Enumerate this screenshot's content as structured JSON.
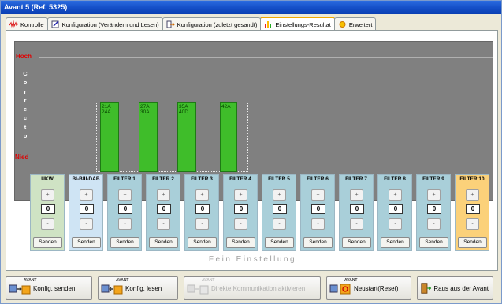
{
  "window": {
    "title": "Avant 5 (Ref. 5325)"
  },
  "tabs": [
    {
      "label": "Kontrolle",
      "icon": "wave-icon",
      "active": false
    },
    {
      "label": "Konfiguration (Verändern und Lesen)",
      "icon": "edit-icon",
      "active": false
    },
    {
      "label": "Konfiguration (zuletzt gesandt)",
      "icon": "arrow-icon",
      "active": false
    },
    {
      "label": "Einstellungs-Resultat",
      "icon": "bar-chart-icon",
      "active": true
    },
    {
      "label": "Erweitert",
      "icon": "sun-icon",
      "active": false
    }
  ],
  "chart": {
    "high_label": "Hoch",
    "low_label": "Nied",
    "axis_letters": [
      "C",
      "o",
      "r",
      "r",
      "e",
      "c",
      "t",
      "o"
    ],
    "bars": [
      {
        "line1": "21A",
        "line2": "24A"
      },
      {
        "line1": "27A",
        "line2": "30A"
      },
      {
        "line1": "35A",
        "line2": "40D"
      },
      {
        "line1": "42A",
        "line2": ""
      }
    ]
  },
  "filters": [
    {
      "label": "UKW",
      "value": "0",
      "send": "Senden",
      "color": "#cfe3c4"
    },
    {
      "label": "BI-BIII-DAB",
      "value": "0",
      "send": "Senden",
      "color": "#cfe4f4"
    },
    {
      "label": "FILTER 1",
      "value": "0",
      "send": "Senden",
      "color": "#a9cfd9"
    },
    {
      "label": "FILTER 2",
      "value": "0",
      "send": "Senden",
      "color": "#a9cfd9"
    },
    {
      "label": "FILTER 3",
      "value": "0",
      "send": "Senden",
      "color": "#a9cfd9"
    },
    {
      "label": "FILTER 4",
      "value": "0",
      "send": "Senden",
      "color": "#a9cfd9"
    },
    {
      "label": "FILTER 5",
      "value": "0",
      "send": "Senden",
      "color": "#a9cfd9"
    },
    {
      "label": "FILTER 6",
      "value": "0",
      "send": "Senden",
      "color": "#a9cfd9"
    },
    {
      "label": "FILTER 7",
      "value": "0",
      "send": "Senden",
      "color": "#a9cfd9"
    },
    {
      "label": "FILTER 8",
      "value": "0",
      "send": "Senden",
      "color": "#a9cfd9"
    },
    {
      "label": "FILTER 9",
      "value": "0",
      "send": "Senden",
      "color": "#a9cfd9"
    },
    {
      "label": "FILTER 10",
      "value": "0",
      "send": "Senden",
      "color": "#fbd17a"
    }
  ],
  "fine_tuning_label": "Fein Einstellung",
  "bottom": {
    "send_config": "Konfig. senden",
    "read_config": "Konfig. lesen",
    "direct_comm": "Direkte Kommunikation aktivieren",
    "restart": "Neustart(Reset)",
    "exit": "Raus aus der Avant",
    "avant_tag": "AVANT"
  }
}
